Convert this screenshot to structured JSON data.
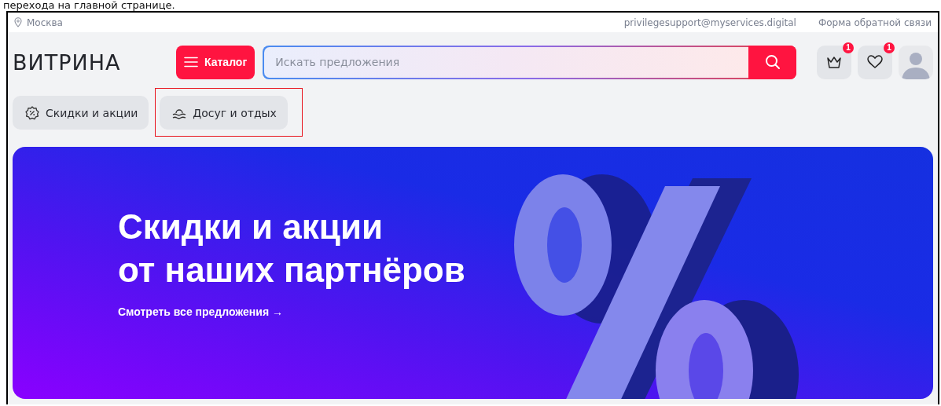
{
  "caption": "перехода на главной странице.",
  "topbar": {
    "location": "Москва",
    "email": "privilegesupport@myservices.digital",
    "feedback": "Форма обратной связи"
  },
  "header": {
    "logo": "ВИТРИНА",
    "catalog_button": "Каталог",
    "search": {
      "placeholder": "Искать предложения"
    },
    "actions": [
      {
        "kind": "crown",
        "badge": "1"
      },
      {
        "kind": "heart",
        "badge": "1"
      },
      {
        "kind": "avatar"
      }
    ]
  },
  "categories": [
    {
      "kind": "discount",
      "label": "Скидки и акции",
      "highlighted": false
    },
    {
      "kind": "leisure",
      "label": "Досуг и отдых",
      "highlighted": true
    }
  ],
  "banner": {
    "title_lines": [
      "Скидки и акции",
      "от наших партнёров"
    ],
    "link": "Смотреть все предложения →"
  }
}
